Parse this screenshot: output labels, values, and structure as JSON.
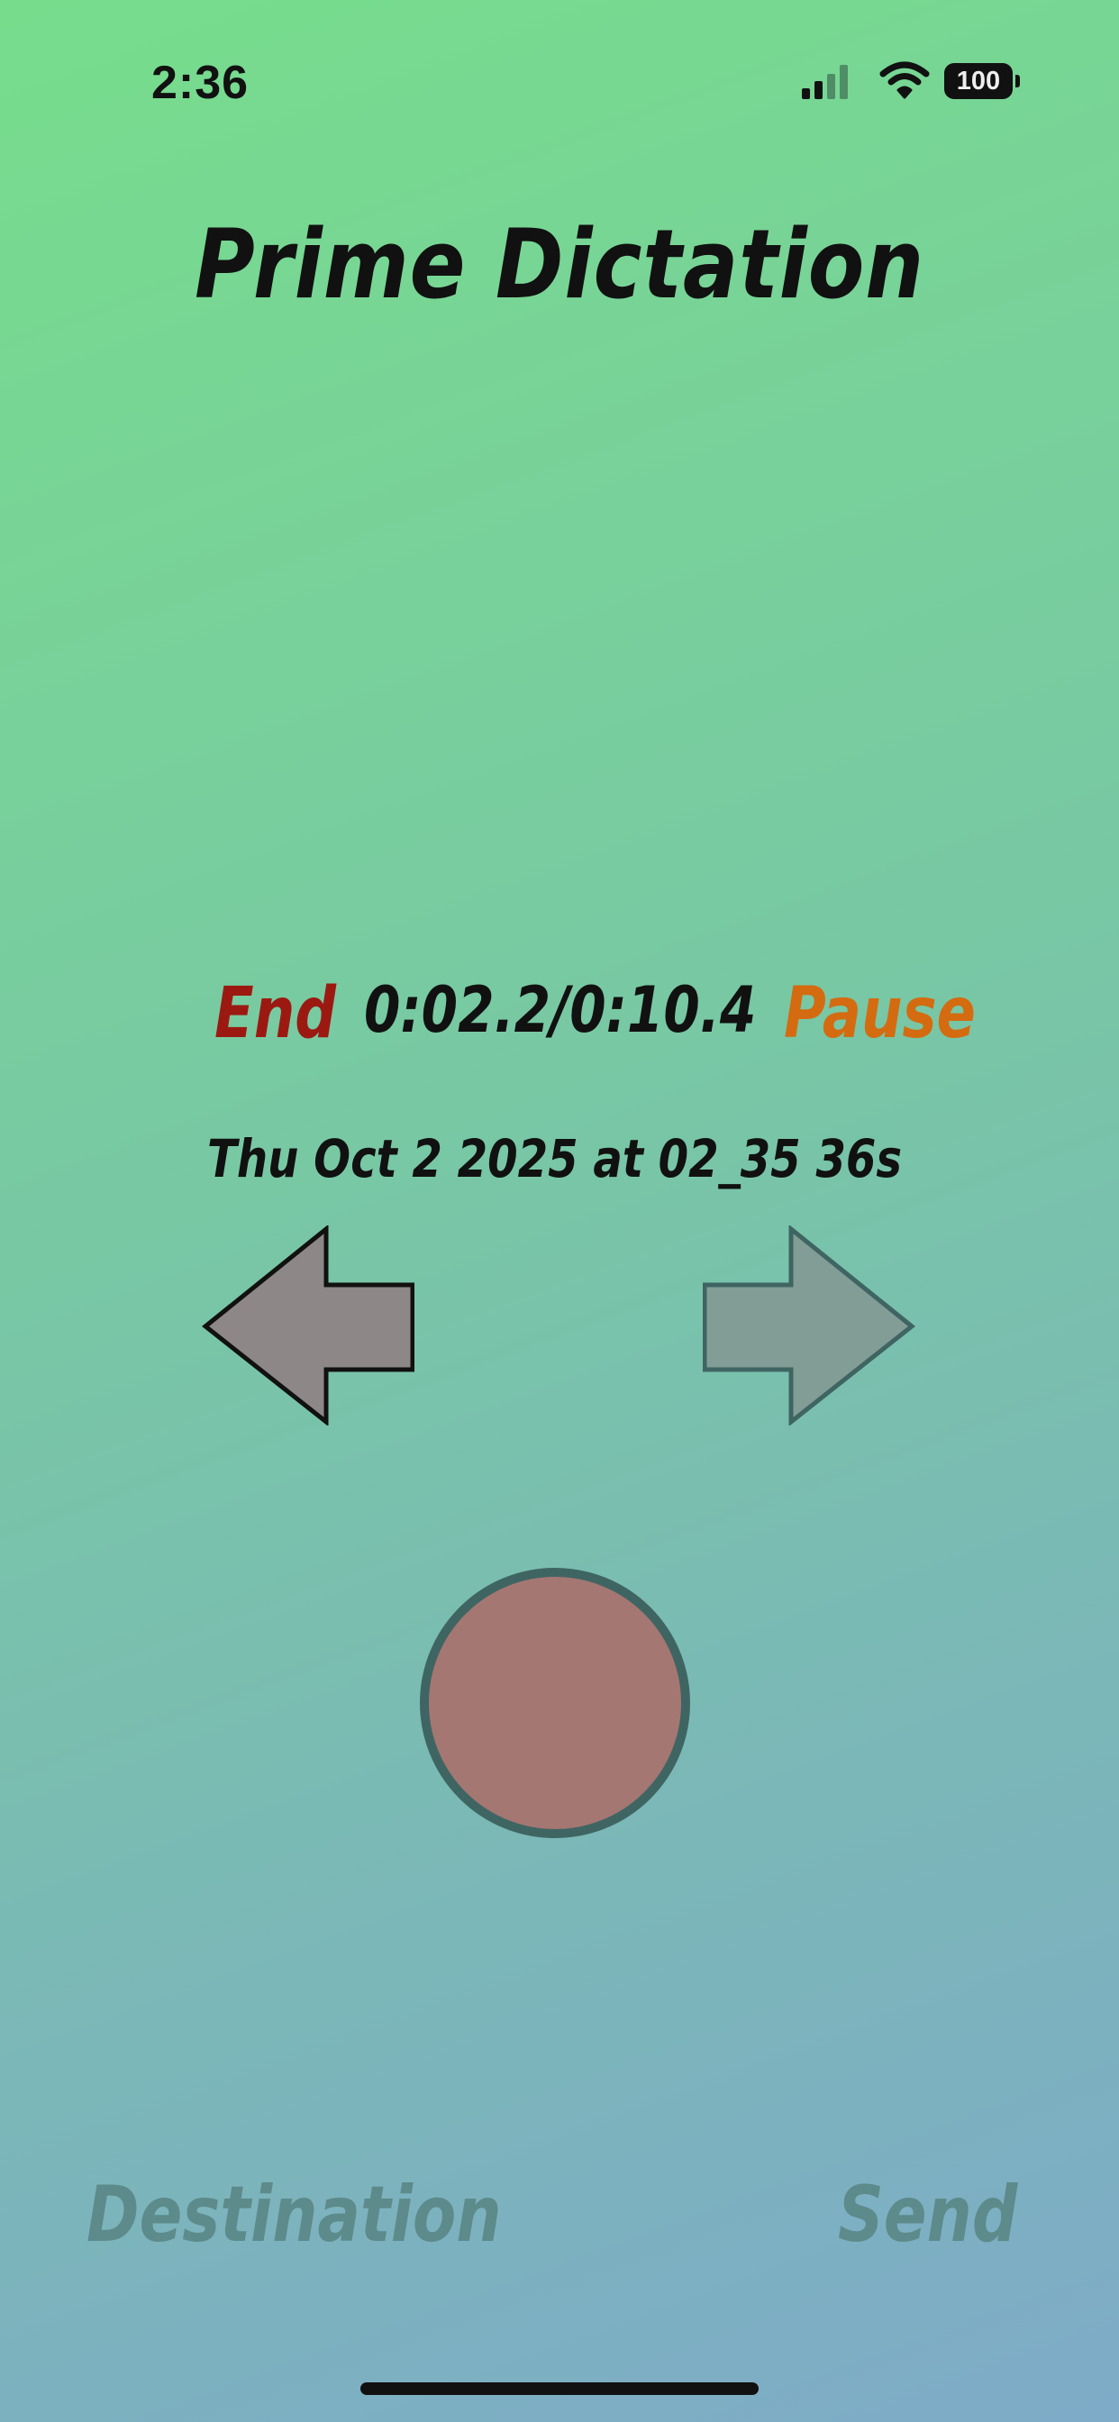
{
  "status_bar": {
    "time": "2:36",
    "battery": "100",
    "icons": [
      "cellular-signal-icon",
      "wifi-icon",
      "battery-icon"
    ]
  },
  "app": {
    "title": "Prime Dictation"
  },
  "playback": {
    "end_label": "End",
    "time_readout": "0:02.2/0:10.4",
    "pause_label": "Pause"
  },
  "recording": {
    "name": "Thu Oct 2 2025 at 02_35 36s"
  },
  "navigation": {
    "previous_icon": "arrow-left-icon",
    "next_icon": "arrow-right-icon"
  },
  "record": {
    "icon": "record-button"
  },
  "bottom_bar": {
    "destination_label": "Destination",
    "send_label": "Send"
  },
  "colors": {
    "end": "#9c1912",
    "pause": "#d46b10",
    "record_fill": "#a57772",
    "disabled_text": "#5d8a8a"
  }
}
